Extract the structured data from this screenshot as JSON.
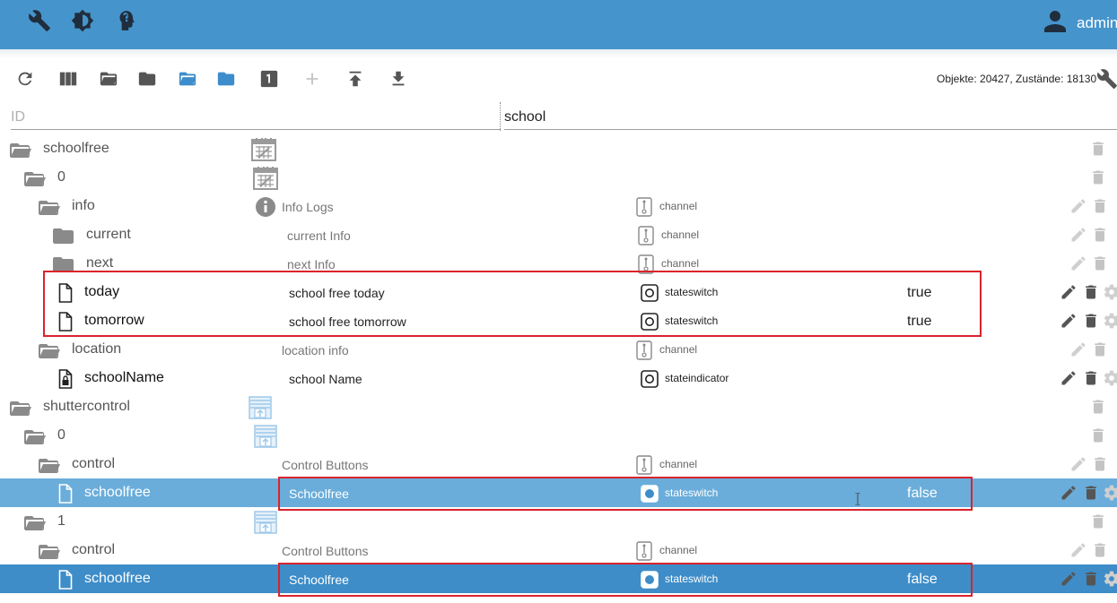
{
  "header": {
    "icons": [
      "wrench-icon",
      "brightness-icon",
      "head-icon"
    ],
    "user": "admin",
    "bg": "#4694cc"
  },
  "toolbar": {
    "icons": [
      "refresh-icon",
      "columns-icon",
      "folder-open-icon",
      "folder-icon",
      "folder-open-blue-icon",
      "folder-blue-icon",
      "number-one-icon",
      "plus-icon",
      "upload-icon",
      "download-icon"
    ],
    "counts": "Objekte: 20427, Zustände: 18130"
  },
  "filter": {
    "id_placeholder": "ID",
    "name_value": "school"
  },
  "rows": [
    {
      "id": "schoolfree",
      "kind": "folder-open",
      "role_icon": "calendar-icon"
    },
    {
      "id": "0",
      "kind": "folder-open",
      "role_icon": "calendar-icon"
    },
    {
      "id": "info",
      "kind": "folder-open",
      "role_icon": "info-icon",
      "name": "Info Logs",
      "type": "channel"
    },
    {
      "id": "current",
      "kind": "folder",
      "name": "current Info",
      "type": "channel"
    },
    {
      "id": "next",
      "kind": "folder",
      "name": "next Info",
      "type": "channel"
    },
    {
      "id": "today",
      "kind": "file",
      "name": "school free today",
      "type": "stateswitch",
      "value": "true"
    },
    {
      "id": "tomorrow",
      "kind": "file",
      "name": "school free tomorrow",
      "type": "stateswitch",
      "value": "true"
    },
    {
      "id": "location",
      "kind": "folder-open",
      "name": "location info",
      "type": "channel"
    },
    {
      "id": "schoolName",
      "kind": "file-lock",
      "name": "school Name",
      "type": "stateindicator"
    },
    {
      "id": "shuttercontrol",
      "kind": "folder-open",
      "role_icon": "shutter-icon"
    },
    {
      "id": "0",
      "kind": "folder-open",
      "role_icon": "shutter-icon"
    },
    {
      "id": "control",
      "kind": "folder-open",
      "name": "Control Buttons",
      "type": "channel"
    },
    {
      "id": "schoolfree",
      "kind": "file",
      "name": "Schoolfree",
      "type": "stateswitch",
      "value": "false"
    },
    {
      "id": "1",
      "kind": "folder-open",
      "role_icon": "shutter-icon"
    },
    {
      "id": "control",
      "kind": "folder-open",
      "name": "Control Buttons",
      "type": "channel"
    },
    {
      "id": "schoolfree",
      "kind": "file",
      "name": "Schoolfree",
      "type": "stateswitch",
      "value": "false"
    }
  ],
  "colors": {
    "selected_light": "#6aaddb",
    "selected_dark": "#3e8dc8",
    "highlight_border": "#d9232c"
  }
}
